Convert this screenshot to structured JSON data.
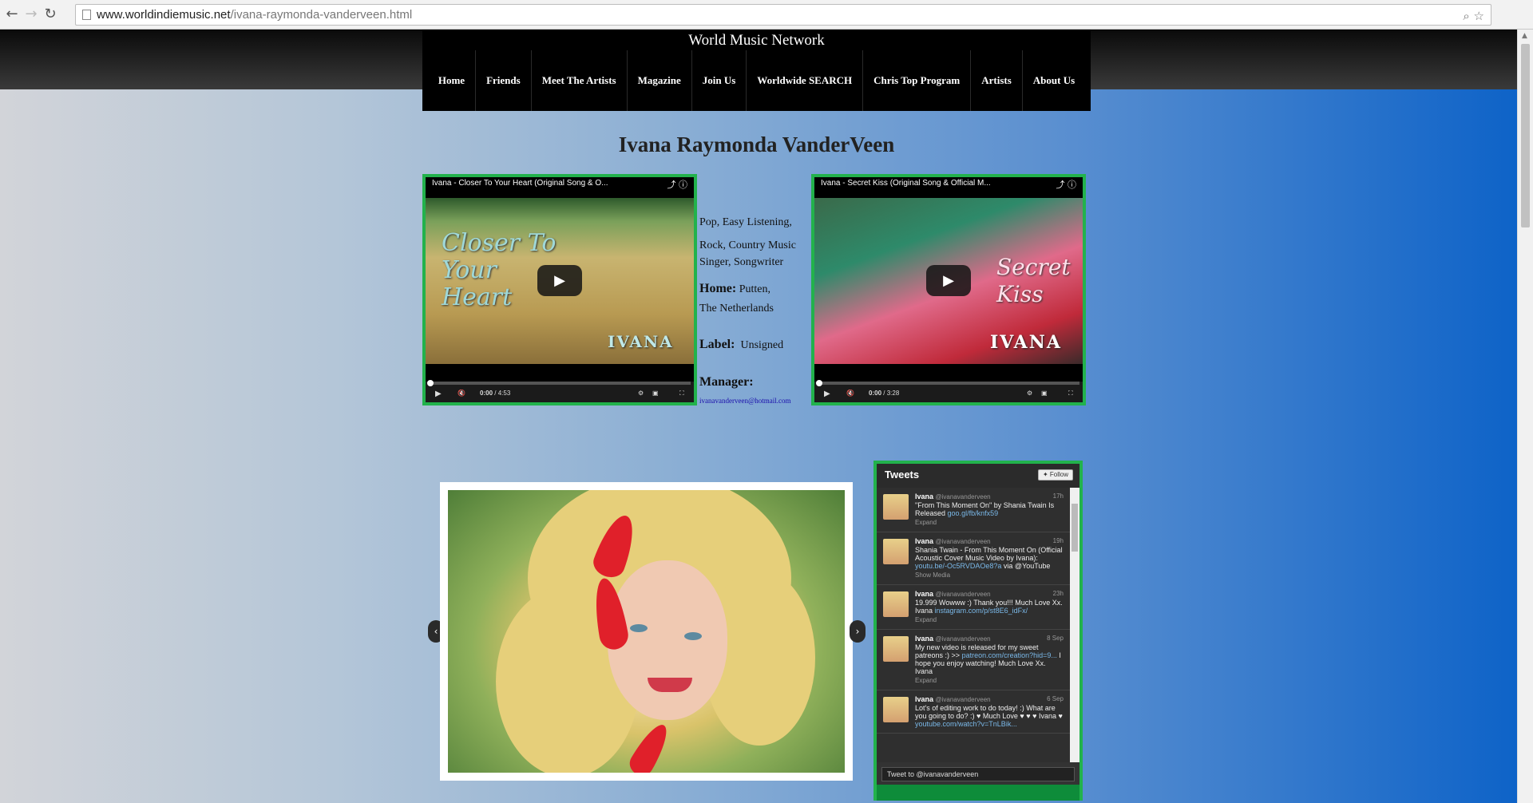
{
  "browser": {
    "url_domain": "www.worldindiemusic.net",
    "url_path": "/ivana-raymonda-vanderveen.html",
    "back_icon": "arrow-left-icon",
    "forward_icon": "arrow-right-icon",
    "reload_icon": "reload-icon"
  },
  "site": {
    "title": "World Music Network",
    "menu": [
      "Home",
      "Friends",
      "Meet The Artists",
      "Magazine",
      "Join Us",
      "Worldwide SEARCH",
      "Chris Top Program",
      "Artists",
      "About Us"
    ]
  },
  "artist": {
    "name": "Ivana Raymonda VanderVeen",
    "genres_line1": "Pop, Easy Listening,",
    "genres_line2": "Rock, Country Music",
    "role": "Singer, Songwriter",
    "home_label": "Home:",
    "home_value_1": "Putten,",
    "home_value_2": "The Netherlands",
    "label_label": "Label:",
    "label_value": "Unsigned",
    "manager_label": "Manager:",
    "manager_email": "ivanavanderveen@hotmail.com"
  },
  "videos": [
    {
      "title": "Ivana - Closer To Your Heart (Original Song & O...",
      "time": "0:00",
      "duration": "/ 4:53",
      "thumb_text": "Closer To Your Heart",
      "thumb_brand": "IVANA"
    },
    {
      "title": "Ivana - Secret Kiss (Original Song & Official M...",
      "time": "0:00",
      "duration": "/ 3:28",
      "thumb_text": "Secret Kiss",
      "thumb_brand": "IVANA"
    }
  ],
  "tweets_widget": {
    "title": "Tweets",
    "follow": "Follow",
    "compose_placeholder": "Tweet to @ivanavanderveen",
    "tweets": [
      {
        "name": "Ivana",
        "handle": "@ivanavanderveen",
        "time": "17h",
        "text": "\"From This Moment On\" by Shania Twain Is Released",
        "link": "goo.gl/fb/knfx59",
        "after": "",
        "action": "Expand"
      },
      {
        "name": "Ivana",
        "handle": "@ivanavanderveen",
        "time": "19h",
        "text": "Shania Twain - From This Moment On (Official Acoustic Cover Music Video by Ivana):",
        "link": "youtu.be/-Oc5RVDAOe8?a",
        "after": "via @YouTube",
        "action": "Show Media"
      },
      {
        "name": "Ivana",
        "handle": "@ivanavanderveen",
        "time": "23h",
        "text": "19.999 Wowww :) Thank you!!! Much Love Xx. Ivana",
        "link": "instagram.com/p/st8E6_idFx/",
        "after": "",
        "action": "Expand"
      },
      {
        "name": "Ivana",
        "handle": "@ivanavanderveen",
        "time": "8 Sep",
        "text": "My new video is released for my sweet patreons :) >>",
        "link": "patreon.com/creation?hid=9...",
        "after": "I hope you enjoy watching! Much Love Xx. Ivana",
        "action": "Expand"
      },
      {
        "name": "Ivana",
        "handle": "@ivanavanderveen",
        "time": "6 Sep",
        "text": "Lot's of editing work to do today! :) What are you going to do? :) ♥ Much Love ♥ ♥ ♥ Ivana ♥",
        "link": "youtube.com/watch?v=TnLBik...",
        "after": "",
        "action": ""
      }
    ]
  }
}
